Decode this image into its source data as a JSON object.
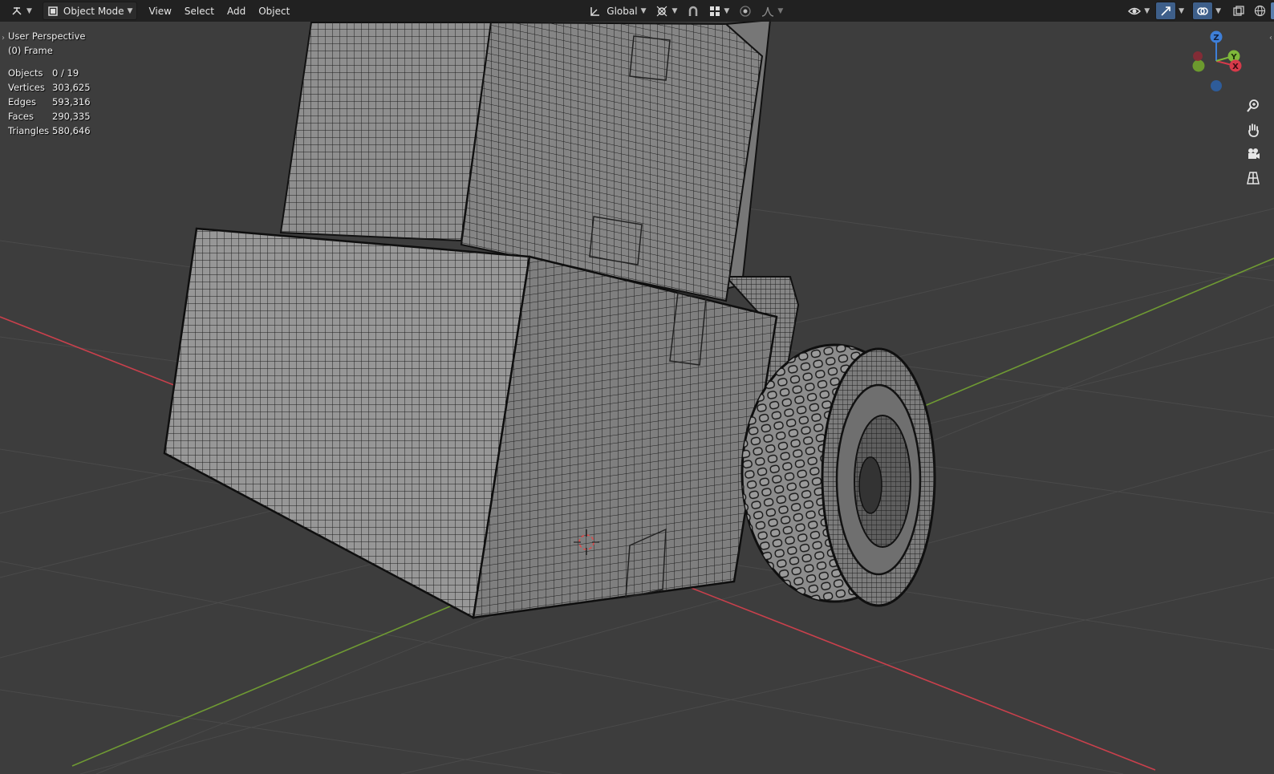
{
  "header": {
    "mode_label": "Object Mode",
    "menus": [
      "View",
      "Select",
      "Add",
      "Object"
    ],
    "orientation_label": "Global"
  },
  "overlay": {
    "view_name": "User Perspective",
    "collection": "(0) Frame",
    "stats": [
      {
        "label": "Objects",
        "value": "0 / 19"
      },
      {
        "label": "Vertices",
        "value": "303,625"
      },
      {
        "label": "Edges",
        "value": "593,316"
      },
      {
        "label": "Faces",
        "value": "290,335"
      },
      {
        "label": "Triangles",
        "value": "580,646"
      }
    ]
  },
  "gizmo": {
    "z": "Z",
    "y": "Y",
    "x": "X"
  },
  "colors": {
    "viewport_bg": "#3d3d3d",
    "header_bg": "#1e1e1e",
    "x_axis": "#d63a4a",
    "y_axis": "#7fb83a",
    "z_axis": "#3e7fd8",
    "mesh_face": "#8e8e8e",
    "wire": "#1a1a1a"
  },
  "icons": {
    "editor_type": "editor-type-icon",
    "object_mode": "object-mode-icon",
    "transform_orientation": "orientation-icon",
    "pivot": "pivot-icon",
    "snap": "snap-magnet-icon",
    "snap_target": "snap-grid-icon",
    "proportional": "proportional-edit-icon",
    "falloff": "falloff-icon",
    "visibility": "eye-icon",
    "gizmo_toggle": "gizmo-icon",
    "overlay": "overlay-icon",
    "xray": "xray-icon",
    "shading_wire": "wireframe-shading-icon",
    "shading_solid": "solid-shading-icon",
    "shading_material": "material-shading-icon",
    "shading_render": "render-shading-icon",
    "zoom": "zoom-icon",
    "pan": "hand-icon",
    "camera": "camera-icon",
    "ortho": "grid-ortho-icon"
  }
}
